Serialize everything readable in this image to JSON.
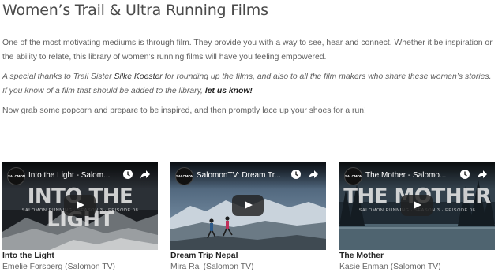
{
  "page": {
    "title": "Women’s Trail & Ultra Running Films"
  },
  "intro": {
    "paragraph1": "One of the most motivating mediums is through film. They provide you with a way to see, hear and connect. Whether it be inspiration or the ability to relate, this library of women’s running films will have you feeling empowered.",
    "thanks_prefix": "A special thanks to Trail Sister ",
    "thanks_name": "Silke Koester",
    "thanks_middle": " for rounding up the films, and also to all the film makers who share these women’s stories.  If you know of a film that should be added to the library, ",
    "thanks_link": "let us know!",
    "paragraph3": "Now grab some popcorn and prepare to be inspired, and then promptly lace up your shoes for a run!"
  },
  "videos": [
    {
      "player_title": "Into the Light - Salom...",
      "channel_icon_text": "SALOMON",
      "thumb_title": "INTO THE LIGHT",
      "thumb_subtitle": "SALOMON RUNNING · SEASON 3 · EPISODE 08",
      "caption_title": "Into the Light",
      "caption_sub": "Emelie Forsberg (Salomon TV)"
    },
    {
      "player_title": "SalomonTV: Dream Tr...",
      "channel_icon_text": "SALOMON",
      "caption_title": "Dream Trip Nepal",
      "caption_sub": "Mira Rai (Salomon TV)"
    },
    {
      "player_title": "The Mother - Salomo...",
      "channel_icon_text": "SALOMON",
      "thumb_title": "THE MOTHER",
      "thumb_subtitle": "SALOMON RUNNING · SEASON 3 · EPISODE 06",
      "caption_title": "The Mother",
      "caption_sub": "Kasie Enman (Salomon TV)"
    }
  ],
  "icons": {
    "watch_later": "clock-icon",
    "share": "share-icon",
    "play": "play-icon"
  },
  "colors": {
    "text": "#5f5f5f",
    "heading": "#4a4a4a",
    "caption_title": "#222222"
  }
}
